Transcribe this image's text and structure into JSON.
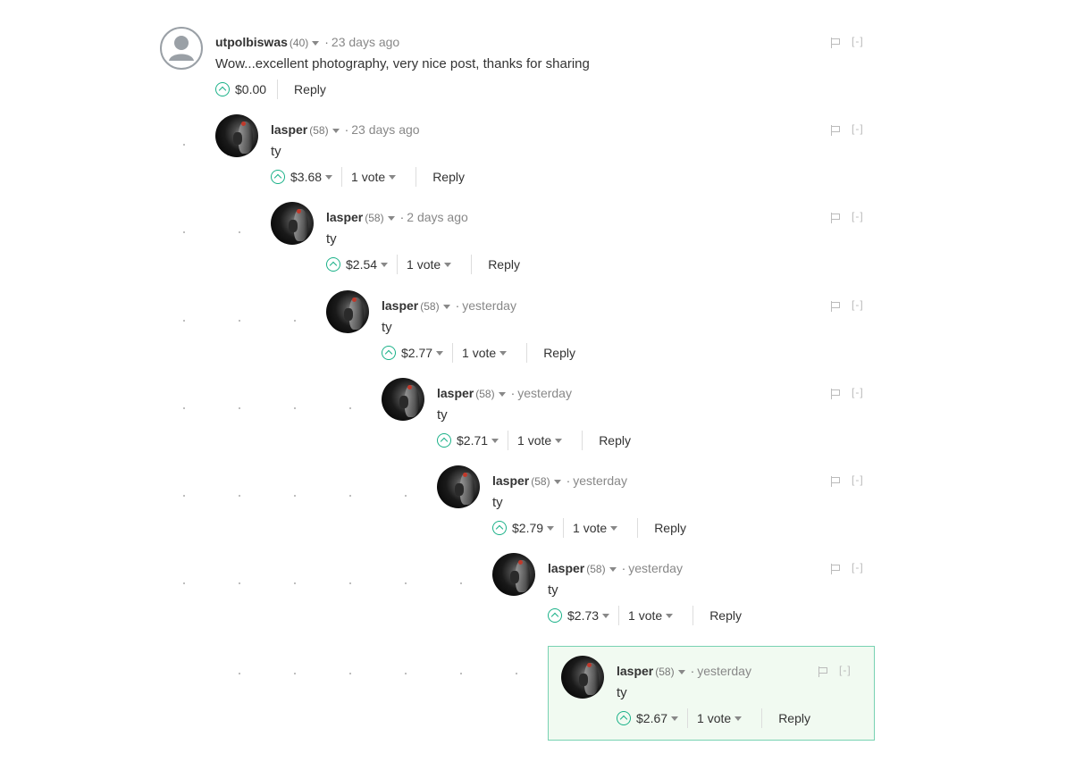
{
  "comments": [
    {
      "author": "utpolbiswas",
      "reputation": "(40)",
      "time": "23 days ago",
      "body": "Wow...excellent photography, very nice post, thanks for sharing",
      "payout": "$0.00",
      "votes": "",
      "reply": "Reply",
      "collapse": "[-]"
    },
    {
      "author": "lasper",
      "reputation": "(58)",
      "time": "23 days ago",
      "body": "ty",
      "payout": "$3.68",
      "votes": "1 vote",
      "reply": "Reply",
      "collapse": "[-]"
    },
    {
      "author": "lasper",
      "reputation": "(58)",
      "time": "2 days ago",
      "body": "ty",
      "payout": "$2.54",
      "votes": "1 vote",
      "reply": "Reply",
      "collapse": "[-]"
    },
    {
      "author": "lasper",
      "reputation": "(58)",
      "time": "yesterday",
      "body": "ty",
      "payout": "$2.77",
      "votes": "1 vote",
      "reply": "Reply",
      "collapse": "[-]"
    },
    {
      "author": "lasper",
      "reputation": "(58)",
      "time": "yesterday",
      "body": "ty",
      "payout": "$2.71",
      "votes": "1 vote",
      "reply": "Reply",
      "collapse": "[-]"
    },
    {
      "author": "lasper",
      "reputation": "(58)",
      "time": "yesterday",
      "body": "ty",
      "payout": "$2.79",
      "votes": "1 vote",
      "reply": "Reply",
      "collapse": "[-]"
    },
    {
      "author": "lasper",
      "reputation": "(58)",
      "time": "yesterday",
      "body": "ty",
      "payout": "$2.73",
      "votes": "1 vote",
      "reply": "Reply",
      "collapse": "[-]"
    },
    {
      "author": "lasper",
      "reputation": "(58)",
      "time": "yesterday",
      "body": "ty",
      "payout": "$2.67",
      "votes": "1 vote",
      "reply": "Reply",
      "collapse": "[-]"
    }
  ],
  "colors": {
    "upvote": "#1ab188",
    "highlight_bg": "#f1faf1",
    "highlight_border": "#78d2b2"
  }
}
